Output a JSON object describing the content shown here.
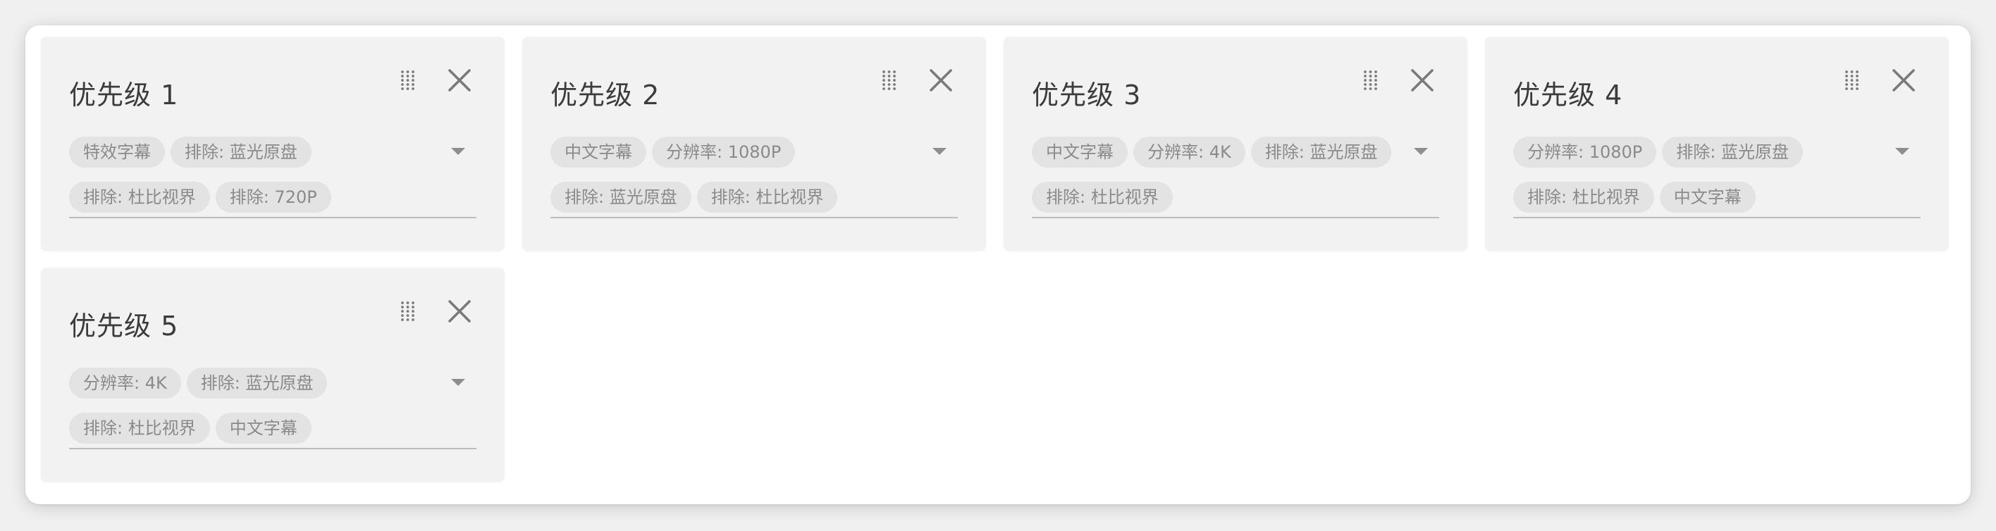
{
  "cards": [
    {
      "title": "优先级 1",
      "tags": [
        "特效字幕",
        "排除: 蓝光原盘",
        "排除: 杜比视界",
        "排除: 720P"
      ]
    },
    {
      "title": "优先级 2",
      "tags": [
        "中文字幕",
        "分辨率: 1080P",
        "排除: 蓝光原盘",
        "排除: 杜比视界"
      ]
    },
    {
      "title": "优先级 3",
      "tags": [
        "中文字幕",
        "分辨率: 4K",
        "排除: 蓝光原盘",
        "排除: 杜比视界"
      ]
    },
    {
      "title": "优先级 4",
      "tags": [
        "分辨率: 1080P",
        "排除: 蓝光原盘",
        "排除: 杜比视界",
        "中文字幕"
      ]
    },
    {
      "title": "优先级 5",
      "tags": [
        "分辨率: 4K",
        "排除: 蓝光原盘",
        "排除: 杜比视界",
        "中文字幕"
      ]
    }
  ],
  "icons": {
    "drag": "drag-handle-icon",
    "close": "close-icon",
    "dropdown": "dropdown-arrow-icon"
  },
  "colors": {
    "card_background": "#f2f2f2",
    "chip_background": "#e3e3e3",
    "chip_text": "#8a8a8a",
    "title_text": "#3c3c3c",
    "icon": "#7a7a7a"
  }
}
